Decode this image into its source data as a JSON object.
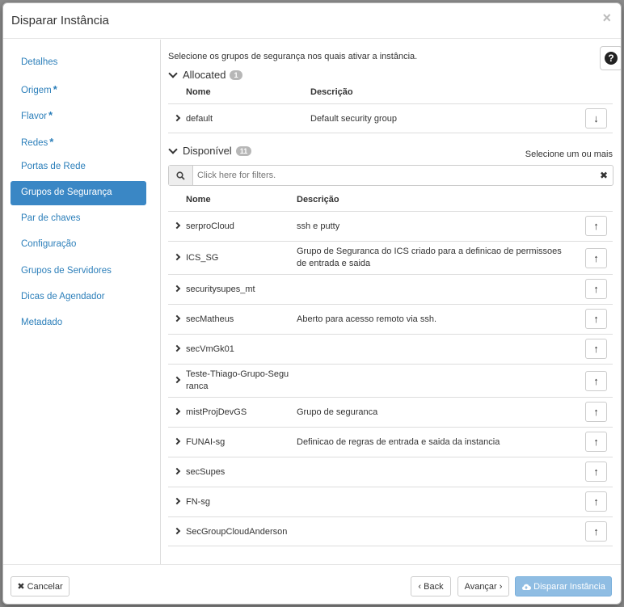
{
  "modal": {
    "title": "Disparar Instância",
    "close": "×"
  },
  "sidebar": {
    "items": [
      {
        "label": "Detalhes",
        "required": false
      },
      {
        "label": "Origem",
        "required": true
      },
      {
        "label": "Flavor",
        "required": true
      },
      {
        "label": "Redes",
        "required": true
      },
      {
        "label": "Portas de Rede",
        "required": false
      },
      {
        "label": "Grupos de Segurança",
        "required": false,
        "active": true
      },
      {
        "label": "Par de chaves",
        "required": false
      },
      {
        "label": "Configuração",
        "required": false
      },
      {
        "label": "Grupos de Servidores",
        "required": false
      },
      {
        "label": "Dicas de Agendador",
        "required": false
      },
      {
        "label": "Metadado",
        "required": false
      }
    ],
    "required_mark": "*"
  },
  "content": {
    "intro": "Selecione os grupos de segurança nos quais ativar a instância.",
    "help": "?",
    "allocated": {
      "title": "Allocated",
      "count": "1",
      "columns": {
        "name": "Nome",
        "desc": "Descrição"
      },
      "rows": [
        {
          "name": "default",
          "desc": "Default security group"
        }
      ]
    },
    "available": {
      "title": "Disponível",
      "count": "11",
      "hint": "Selecione um ou mais",
      "filter_placeholder": "Click here for filters.",
      "columns": {
        "name": "Nome",
        "desc": "Descrição"
      },
      "rows": [
        {
          "name": "serproCloud",
          "desc": "ssh e putty"
        },
        {
          "name": "ICS_SG",
          "desc": "Grupo de Seguranca do ICS criado para a definicao de permissoes de entrada e saida"
        },
        {
          "name": "securitysupes_mt",
          "desc": ""
        },
        {
          "name": "secMatheus",
          "desc": "Aberto para acesso remoto via ssh."
        },
        {
          "name": "secVmGk01",
          "desc": ""
        },
        {
          "name": "Teste-Thiago-Grupo-Seguranca",
          "desc": ""
        },
        {
          "name": "mistProjDevGS",
          "desc": "Grupo de seguranca"
        },
        {
          "name": "FUNAI-sg",
          "desc": "Definicao de regras de entrada e saida da instancia"
        },
        {
          "name": "secSupes",
          "desc": ""
        },
        {
          "name": "FN-sg",
          "desc": ""
        },
        {
          "name": "SecGroupCloudAnderson",
          "desc": ""
        }
      ]
    }
  },
  "footer": {
    "cancel": "✖ Cancelar",
    "back": "‹ Back",
    "next": "Avançar ›",
    "launch": "Disparar Instância"
  },
  "icons": {
    "search": "search-icon",
    "clear": "times-icon",
    "down": "arrow-down-icon",
    "up": "arrow-up-icon",
    "cloud": "cloud-upload-icon"
  }
}
